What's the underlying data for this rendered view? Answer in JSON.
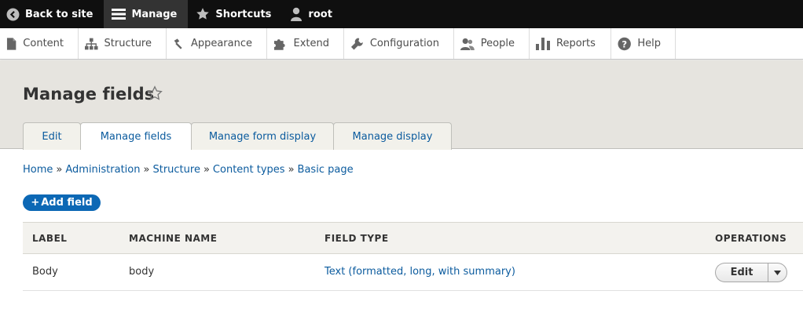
{
  "toolbar": {
    "back_to_site": "Back to site",
    "manage": "Manage",
    "shortcuts": "Shortcuts",
    "user": "root"
  },
  "tray": {
    "items": [
      {
        "label": "Content",
        "icon": "file-icon"
      },
      {
        "label": "Structure",
        "icon": "sitemap-icon"
      },
      {
        "label": "Appearance",
        "icon": "brush-icon"
      },
      {
        "label": "Extend",
        "icon": "puzzle-icon"
      },
      {
        "label": "Configuration",
        "icon": "wrench-icon"
      },
      {
        "label": "People",
        "icon": "people-icon"
      },
      {
        "label": "Reports",
        "icon": "bar-chart-icon"
      },
      {
        "label": "Help",
        "icon": "help-icon"
      }
    ]
  },
  "header": {
    "title": "Manage fields",
    "tabs": [
      {
        "label": "Edit",
        "active": false
      },
      {
        "label": "Manage fields",
        "active": true
      },
      {
        "label": "Manage form display",
        "active": false
      },
      {
        "label": "Manage display",
        "active": false
      }
    ]
  },
  "breadcrumb": {
    "items": [
      "Home",
      "Administration",
      "Structure",
      "Content types",
      "Basic page"
    ],
    "separator": "»"
  },
  "add_field": {
    "label": "Add field",
    "plus": "+"
  },
  "table": {
    "headers": [
      "LABEL",
      "MACHINE NAME",
      "FIELD TYPE",
      "OPERATIONS"
    ],
    "rows": [
      {
        "label": "Body",
        "machine_name": "body",
        "field_type": "Text (formatted, long, with summary)",
        "operation": "Edit"
      }
    ]
  },
  "colors": {
    "toolbar_bg": "#0f0f0f",
    "link": "#0b5b9e",
    "primary_button": "#0c68b5",
    "header_bg": "#e6e4df"
  }
}
